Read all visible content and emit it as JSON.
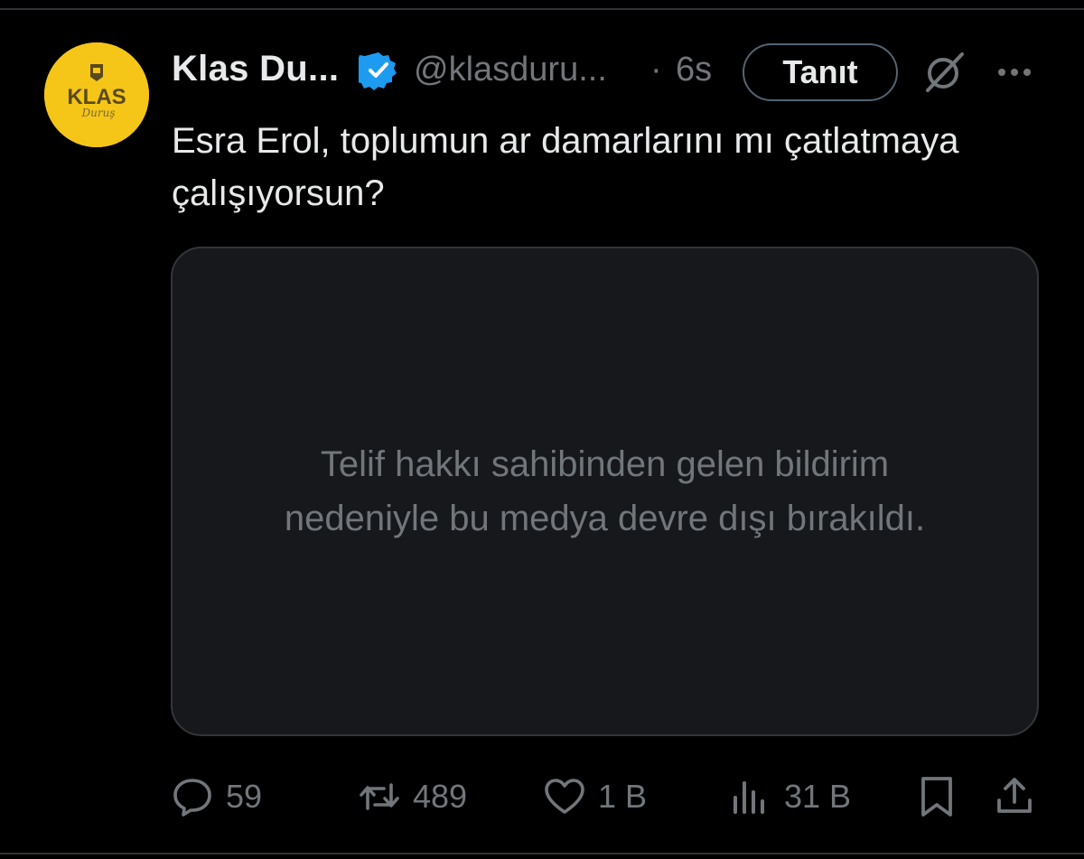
{
  "account": {
    "display_name": "Klas Du...",
    "handle": "@klasduru...",
    "separator": "·",
    "time": "6s",
    "avatar_logo_text": "KLAS",
    "avatar_logo_subtext": "Duruş"
  },
  "header": {
    "follow_label": "Tanıt",
    "grok_icon": "grok-slash-icon",
    "more_icon": "more-horizontal-icon"
  },
  "tweet": {
    "text": "Esra Erol, toplumun ar damarlarını mı çatlatmaya çalışıyorsun?"
  },
  "media": {
    "notice": "Telif hakkı sahibinden gelen bildirim nedeniyle bu medya devre dışı bırakıldı."
  },
  "actions": {
    "replies": "59",
    "reposts": "489",
    "likes": "1 B",
    "views": "31 B"
  },
  "colors": {
    "background": "#000000",
    "text_primary": "#e7e9ea",
    "text_secondary": "#71767b",
    "verified_blue": "#1d9bf0",
    "avatar_yellow": "#f5c518",
    "card_bg": "#16181c",
    "border": "#2f3336"
  }
}
